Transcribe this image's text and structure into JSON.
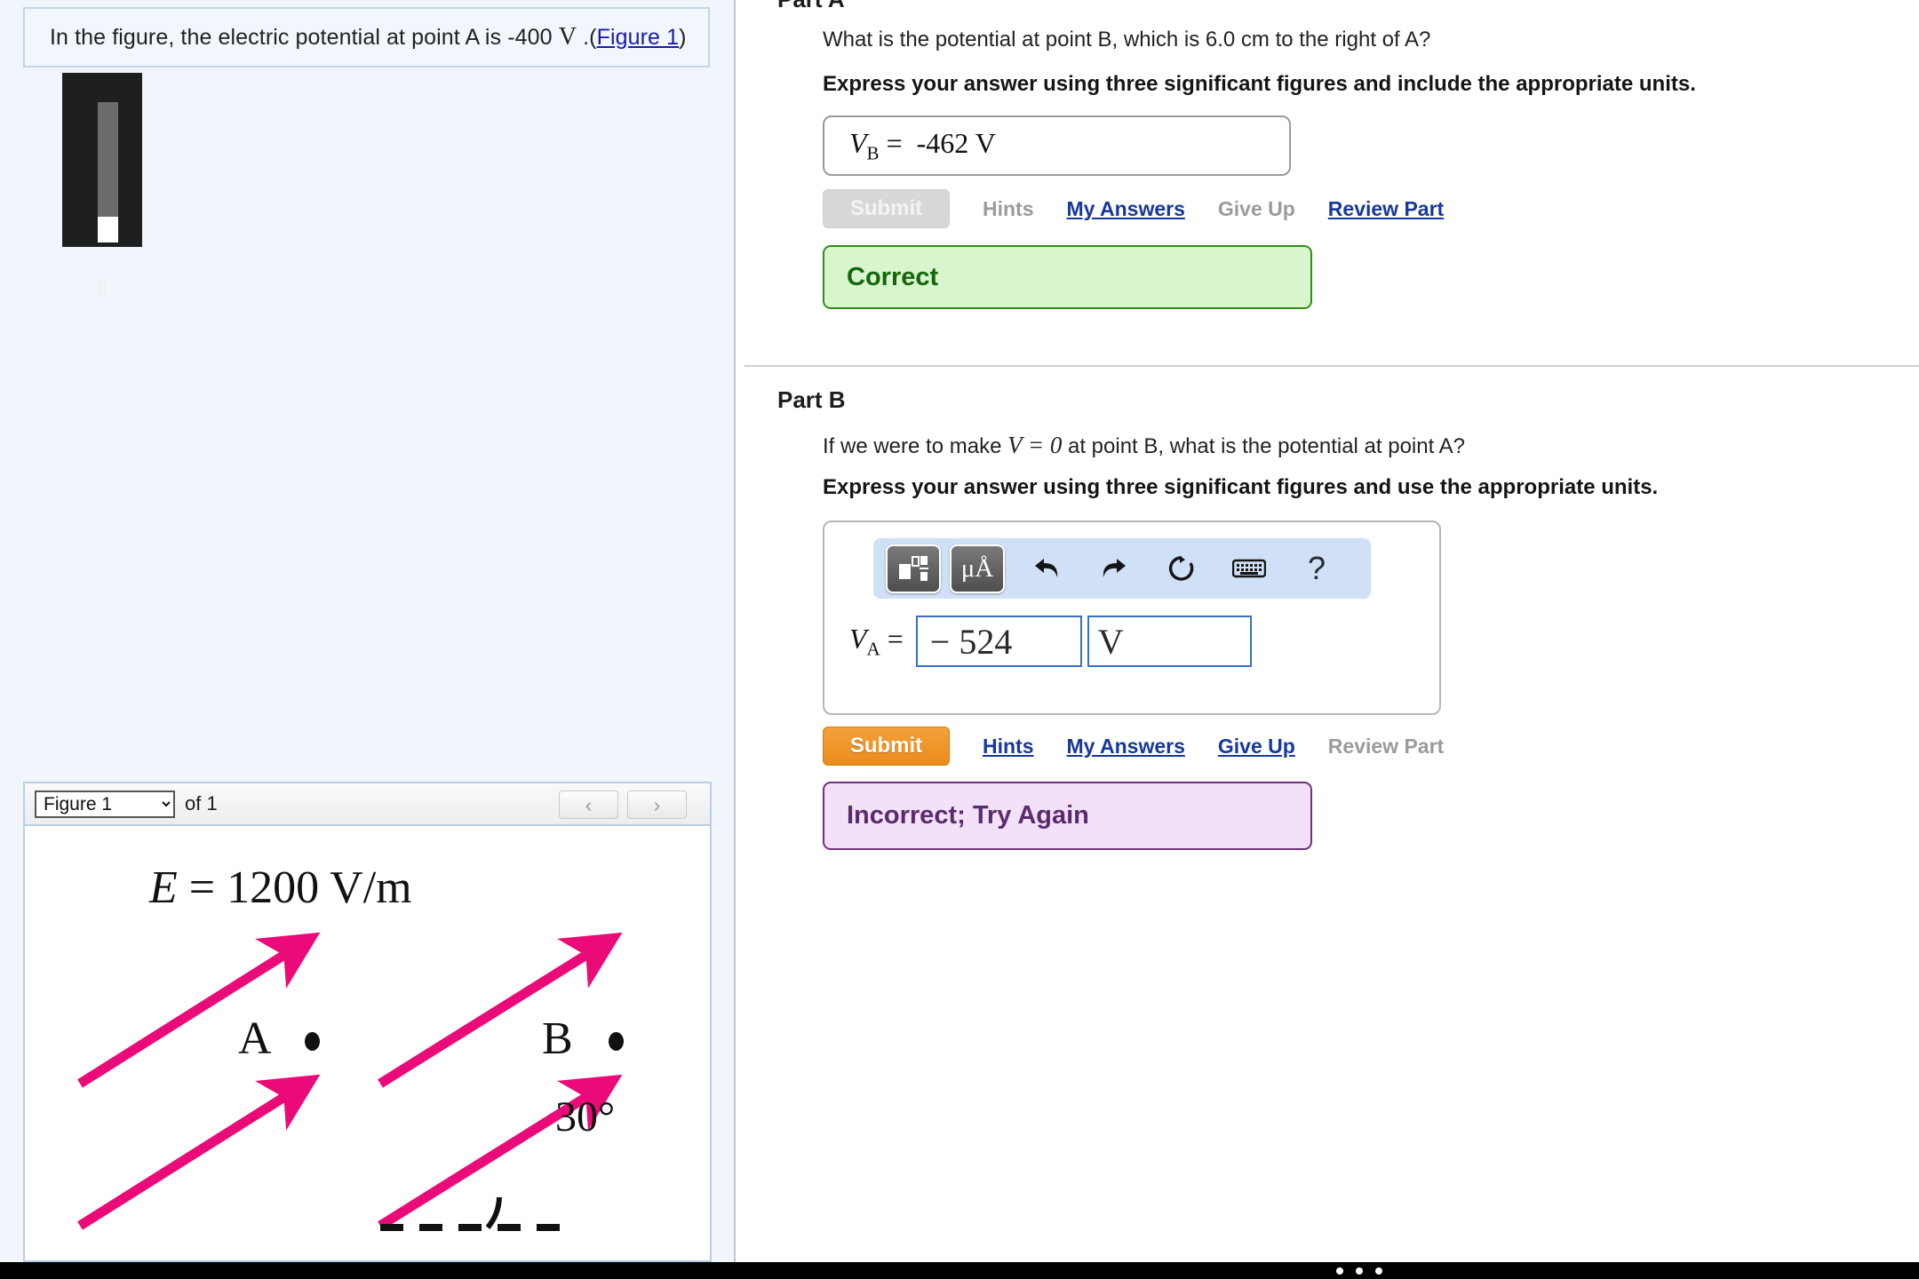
{
  "problem": {
    "text_before": "In the figure, the electric potential at point A is -400",
    "unit_symbol": "V",
    "text_after": ".(",
    "figure_link": "Figure 1",
    "text_close": ")"
  },
  "media_widget": {
    "name": "volume-slider",
    "value_label": "0"
  },
  "part_a": {
    "heading": "Part A",
    "question": "What is the potential at point B, which is 6.0 cm to the right of A?",
    "instruction": "Express your answer using three significant figures and include the appropriate units.",
    "variable": "V",
    "subscript": "B",
    "equals": "=",
    "answer_value": "-462 V",
    "submit_label": "Submit",
    "links": [
      {
        "label": "Hints",
        "state": "muted"
      },
      {
        "label": "My Answers",
        "state": "active"
      },
      {
        "label": "Give Up",
        "state": "muted"
      },
      {
        "label": "Review Part",
        "state": "active"
      }
    ],
    "feedback": "Correct",
    "feedback_bg": "#d9f5cd",
    "feedback_border": "#2f8f16",
    "feedback_color": "#14670c"
  },
  "part_b": {
    "heading": "Part B",
    "question_pre": "If we were to make",
    "question_math": "V = 0",
    "question_post": "at point B, what is the potential at point A?",
    "instruction": "Express your answer using three significant figures and use the appropriate units.",
    "variable": "V",
    "subscript": "A",
    "equals": "=",
    "answer_value": "− 524",
    "answer_unit": "V",
    "submit_label": "Submit",
    "links": [
      {
        "label": "Hints",
        "state": "active"
      },
      {
        "label": "My Answers",
        "state": "active"
      },
      {
        "label": "Give Up",
        "state": "active"
      },
      {
        "label": "Review Part",
        "state": "muted"
      }
    ],
    "feedback": "Incorrect; Try Again",
    "feedback_bg": "#f2e1f8",
    "feedback_border": "#70307f",
    "feedback_color": "#5c2b6e",
    "submit_color": "#ec8b1d"
  },
  "math_toolbar": {
    "template_icon": "template-layout-icon",
    "units_label": "μÅ",
    "undo_icon": "undo-arrow-icon",
    "redo_icon": "redo-arrow-icon",
    "reset_icon": "reset-circular-arrow-icon",
    "keyboard_icon": "keyboard-icon",
    "help_label": "?"
  },
  "figure_panel": {
    "selected": "Figure 1",
    "options": [
      "Figure 1"
    ],
    "count_label": "of 1",
    "prev_icon": "‹",
    "next_icon": "›"
  },
  "figure_content": {
    "equation_italic": "E",
    "equation_rest": " = 1200 V/m",
    "label_a": "A",
    "label_b": "B",
    "angle_label": "30°",
    "arrow_color": "#ea0a78",
    "field_magnitude": "1200",
    "field_unit": "V/m",
    "angle_value": "30"
  },
  "bottom_bar": {
    "dots": 3
  }
}
